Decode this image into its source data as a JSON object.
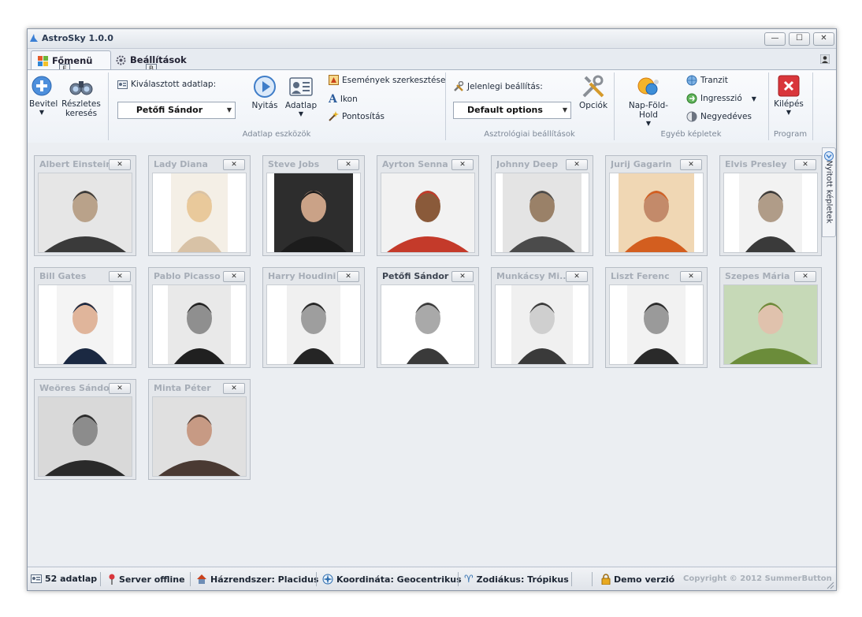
{
  "window": {
    "title": "AstroSky 1.0.0",
    "controls": {
      "minimize": "—",
      "maximize": "☐",
      "close": "✕"
    }
  },
  "tabs": [
    {
      "label": "Főmenü",
      "keytip": "F",
      "active": true
    },
    {
      "label": "Beállítások",
      "keytip": "B",
      "active": false
    }
  ],
  "ribbon": {
    "groups": {
      "adatlap": "Adatlap eszközök",
      "asztro": "Asztrológiai beállítások",
      "egyeb": "Egyéb képletek",
      "program": "Program"
    },
    "bevitel": "Bevitel",
    "reszletes": "Részletes keresés",
    "selected_label": "Kiválasztott adatlap:",
    "selected_value": "Petőfi Sándor",
    "nyitas": "Nyitás",
    "adatlap": "Adatlap",
    "esemenyek": "Események szerkesztése",
    "ikon": "Ikon",
    "pontositas": "Pontosítás",
    "current_label": "Jelenlegi beállítás:",
    "current_value": "Default options",
    "opciok": "Opciók",
    "napfold": "Nap-Föld-Hold",
    "tranzit": "Tranzit",
    "ingresszio": "Ingresszió",
    "negyedeves": "Negyedéves",
    "kilepes": "Kilépés"
  },
  "cards": [
    {
      "name": "Albert Einstein",
      "active": false
    },
    {
      "name": "Lady Diana",
      "active": false
    },
    {
      "name": "Steve Jobs",
      "active": false
    },
    {
      "name": "Ayrton Senna",
      "active": false
    },
    {
      "name": "Johnny Deep",
      "active": false
    },
    {
      "name": "Jurij Gagarin",
      "active": false
    },
    {
      "name": "Elvis Presley",
      "active": false
    },
    {
      "name": "Bill Gates",
      "active": false
    },
    {
      "name": "Pablo Picasso",
      "active": false
    },
    {
      "name": "Harry Houdini",
      "active": false
    },
    {
      "name": "Petőfi Sándor",
      "active": true
    },
    {
      "name": "Munkácsy Mi...",
      "active": false
    },
    {
      "name": "Liszt Ferenc",
      "active": false
    },
    {
      "name": "Szepes Mária",
      "active": false
    },
    {
      "name": "Weöres Sándor",
      "active": false
    },
    {
      "name": "Minta Péter",
      "active": false
    }
  ],
  "side_tab": "Nyitott képletek",
  "status": {
    "count": "52 adatlap",
    "server": "Server offline",
    "house": "Házrendszer: Placidus",
    "coord": "Koordináta: Geocentrikus",
    "zodiac": "Zodiákus: Trópikus",
    "demo": "Demo verzió",
    "copyright": "Copyright © 2012 SummerButton"
  },
  "colors": {
    "accent": "#3b7fd4",
    "close_red": "#d9363b",
    "area": "#ebeef2"
  }
}
